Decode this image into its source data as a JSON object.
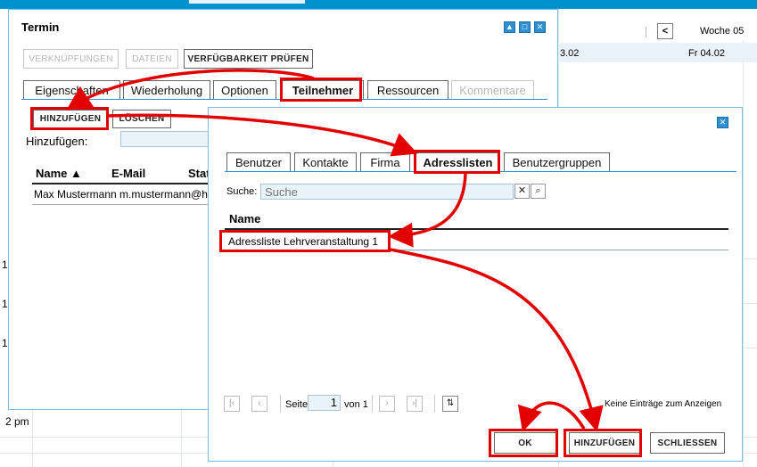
{
  "background_calendar": {
    "week_label": "Woche 05",
    "nav_prev": "<",
    "day_left": "3.02",
    "day_right": "Fr 04.02",
    "time_label": "2 pm",
    "hour_fragments": [
      "1",
      "1",
      "1"
    ]
  },
  "termin_dialog": {
    "title": "Termin",
    "window_buttons": [
      "▲",
      "□",
      "✕"
    ],
    "toolbar": {
      "links_label": "VERKNÜPFUNGEN",
      "files_label": "DATEIEN",
      "availability_label": "VERFÜGBARKEIT PRÜFEN"
    },
    "tabs": [
      "Eigenschaften",
      "Wiederholung",
      "Optionen",
      "Teilnehmer",
      "Ressourcen",
      "Kommentare"
    ],
    "active_tab": "Teilnehmer",
    "add_button": "HINZUFÜGEN",
    "delete_button": "LÖSCHEN",
    "add_label": "Hinzufügen:",
    "table": {
      "columns": [
        "Name ▲",
        "E-Mail",
        "Stat"
      ],
      "rows": [
        [
          "Max Mustermann",
          "m.mustermann@h"
        ]
      ]
    }
  },
  "address_dialog": {
    "close_symbol": "✕",
    "tabs": [
      "Benutzer",
      "Kontakte",
      "Firma",
      "Adresslisten",
      "Benutzergruppen"
    ],
    "active_tab": "Adresslisten",
    "search": {
      "label": "Suche:",
      "placeholder": "Suche",
      "clear_symbol": "✕",
      "search_symbol": "⌕"
    },
    "list": {
      "column": "Name",
      "items": [
        "Adressliste Lehrveranstaltung 1"
      ]
    },
    "pager": {
      "first": "|‹",
      "prev": "‹",
      "page_label": "Seite",
      "page_value": "1",
      "of_label": "von 1",
      "next": "›",
      "last": "›|",
      "refresh": "⇅",
      "status": "Keine Einträge zum Anzeigen"
    },
    "buttons": {
      "ok": "OK",
      "add": "HINZUFÜGEN",
      "close": "SCHLIESSEN"
    }
  },
  "annotation_color": "#e30000"
}
